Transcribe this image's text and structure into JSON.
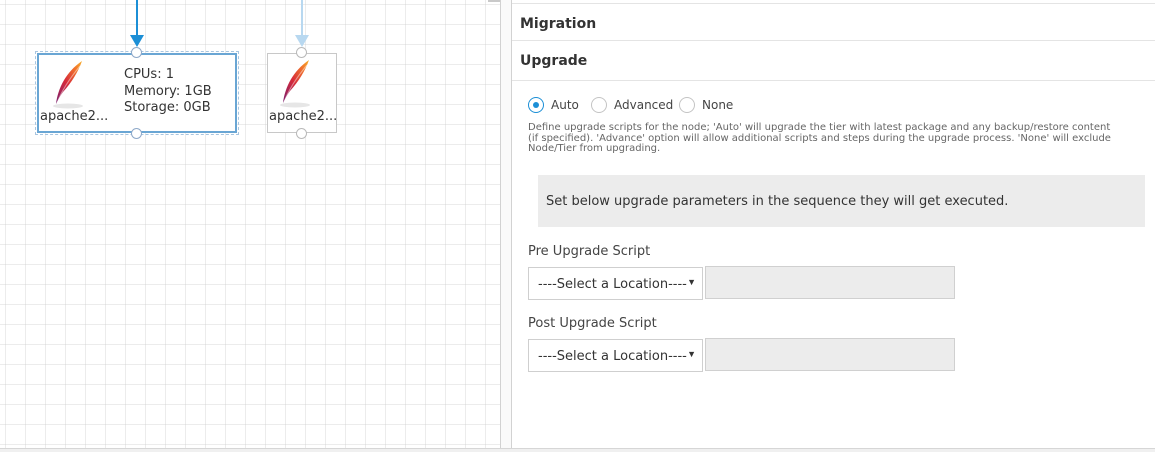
{
  "canvas": {
    "nodes": [
      {
        "label": "apache2...",
        "icon": "apache-feather-icon",
        "selected": true,
        "info": {
          "cpus": "CPUs: 1",
          "memory": "Memory: 1GB",
          "storage": "Storage: 0GB"
        }
      },
      {
        "label": "apache2...",
        "icon": "apache-feather-icon",
        "selected": false
      }
    ],
    "colors": {
      "connector_active": "#1c8fd6",
      "connector_faded": "#b8d8f0"
    }
  },
  "panel": {
    "migration_title": "Migration",
    "upgrade_title": "Upgrade",
    "upgrade_options": [
      {
        "label": "Auto",
        "checked": true
      },
      {
        "label": "Advanced",
        "checked": false
      },
      {
        "label": "None",
        "checked": false
      }
    ],
    "help_text": "Define upgrade scripts for the node; 'Auto' will upgrade the tier with latest package and any backup/restore content (if specified). 'Advance' option will allow additional scripts and steps during the upgrade process. 'None' will exclude Node/Tier from upgrading.",
    "info_message": "Set below upgrade parameters in the sequence they will get executed.",
    "pre_upgrade": {
      "label": "Pre Upgrade Script",
      "select_value": "----Select a Location----",
      "input_value": ""
    },
    "post_upgrade": {
      "label": "Post Upgrade Script",
      "select_value": "----Select a Location----",
      "input_value": ""
    },
    "accent_color": "#1c8fd6"
  }
}
